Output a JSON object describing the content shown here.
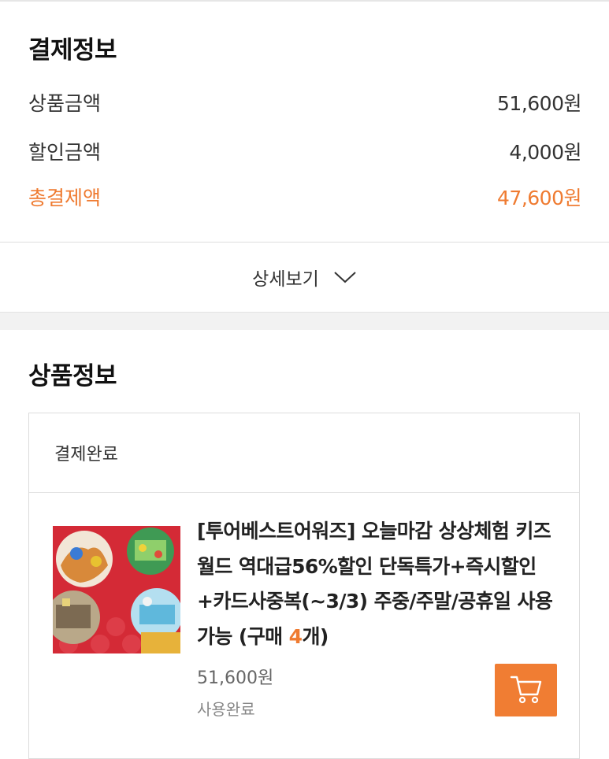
{
  "payment": {
    "title": "결제정보",
    "rows": [
      {
        "label": "상품금액",
        "value": "51,600원"
      },
      {
        "label": "할인금액",
        "value": "4,000원"
      },
      {
        "label": "총결제액",
        "value": "47,600원"
      }
    ],
    "detail_label": "상세보기",
    "accent_color": "#ef7b31"
  },
  "product": {
    "title": "상품정보",
    "status": "결제완료",
    "name_main": "[투어베스트어워즈] 오늘마감 상상체험 키즈월드 역대급56%할인 단독특가+즉시할인+카드사중복(~3/3) 주중/주말/공휴일 사용가능 (구매 ",
    "qty": "4",
    "name_end": "개)",
    "price": "51,600원",
    "use_status": "사용완료",
    "cart_icon": "cart-icon"
  }
}
